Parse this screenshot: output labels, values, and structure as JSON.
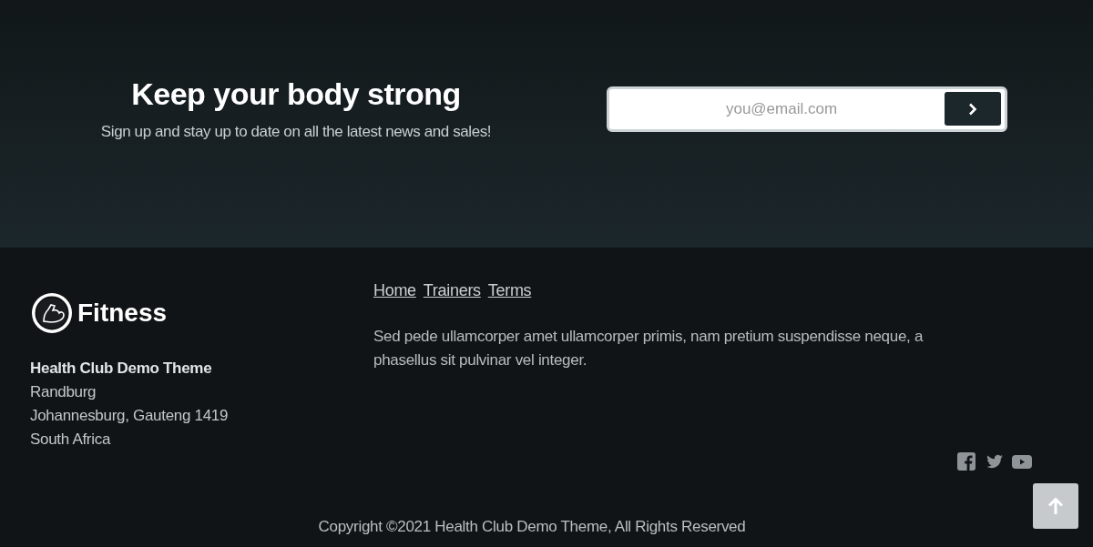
{
  "newsletter": {
    "heading": "Keep your body strong",
    "subtext": "Sign up and stay up to date on all the latest news and sales!",
    "email_field": {
      "placeholder": "you@email.com"
    }
  },
  "brand": {
    "name": "Fitness"
  },
  "address": {
    "company": "Health Club Demo Theme",
    "lines": [
      "Randburg",
      "Johannesburg, Gauteng 1419",
      "South Africa"
    ]
  },
  "footer_links": [
    "Home",
    "Trainers",
    "Terms"
  ],
  "description": "Sed pede ullamcorper amet ullamcorper primis, nam pretium suspendisse neque, a phasellus sit pulvinar vel integer.",
  "social": [
    {
      "kind": "facebook"
    },
    {
      "kind": "twitter"
    },
    {
      "kind": "youtube"
    }
  ],
  "copyright": "Copyright ©2021 Health Club Demo Theme, All Rights Reserved"
}
